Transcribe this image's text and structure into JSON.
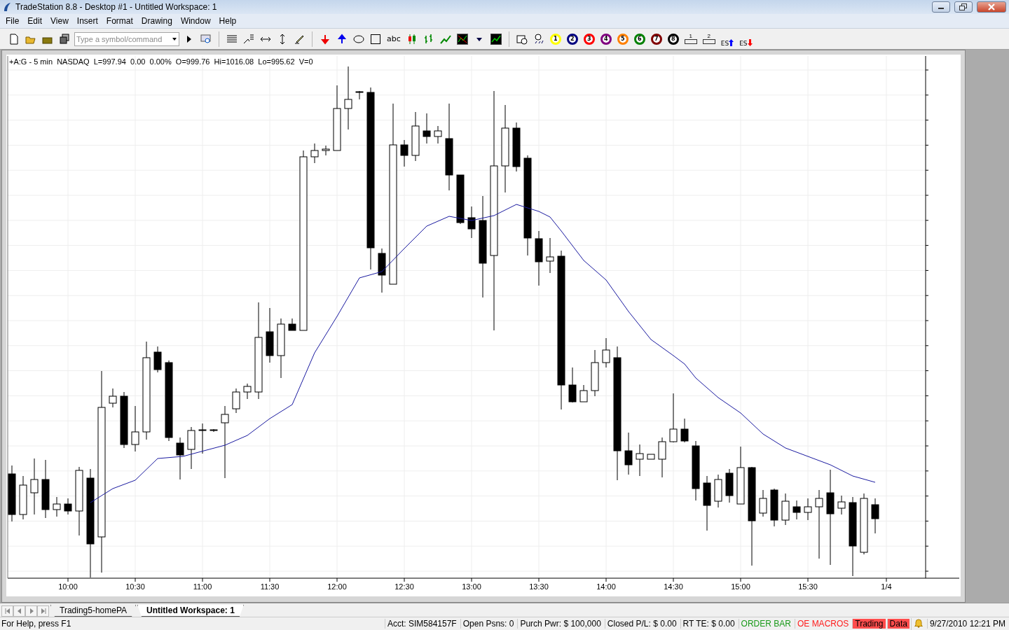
{
  "window": {
    "title": "TradeStation 8.8 - Desktop #1 - Untitled Workspace:  1"
  },
  "menu": [
    "File",
    "Edit",
    "View",
    "Insert",
    "Format",
    "Drawing",
    "Window",
    "Help"
  ],
  "toolbar": {
    "symbol_field": {
      "placeholder": "Type a symbol/command"
    },
    "text_tool": "abc",
    "balls": [
      {
        "label": "1",
        "color": "#ffff00"
      },
      {
        "label": "2",
        "color": "#000080"
      },
      {
        "label": "3",
        "color": "#ff0000"
      },
      {
        "label": "4",
        "color": "#800080"
      },
      {
        "label": "5",
        "color": "#ff8000"
      },
      {
        "label": "6",
        "color": "#008000"
      },
      {
        "label": "7",
        "color": "#800000"
      },
      {
        "label": "8",
        "color": "#000000"
      }
    ],
    "position_buttons": [
      "1",
      "2"
    ],
    "es_buttons": [
      {
        "label": "ES",
        "kind": "up"
      },
      {
        "label": "ES",
        "kind": "down"
      }
    ]
  },
  "chart": {
    "header": "+A:G - 5 min  NASDAQ  L=997.94  0.00  0.00%  O=999.76  Hi=1016.08  Lo=995.62  V=0",
    "time_labels": [
      "10:00",
      "10:30",
      "11:00",
      "11:30",
      "12:00",
      "12:30",
      "13:00",
      "13:30",
      "14:00",
      "14:30",
      "15:00",
      "15:30",
      "1/4"
    ]
  },
  "workspace_tabs": [
    {
      "label": "Trading5-homePA",
      "selected": false
    },
    {
      "label": "Untitled Workspace:  1",
      "selected": true
    }
  ],
  "status_bar": [
    {
      "text": "For Help, press F1",
      "kind": "help"
    },
    {
      "text": "Acct: SIM584157F",
      "kind": "plain"
    },
    {
      "text": "Open Psns: 0",
      "kind": "plain"
    },
    {
      "text": "Purch Pwr: $ 100,000",
      "kind": "plain"
    },
    {
      "text": "Closed P/L: $ 0.00",
      "kind": "plain"
    },
    {
      "text": "RT TE: $ 0.00",
      "kind": "plain"
    },
    {
      "text": "ORDER BAR",
      "kind": "green"
    },
    {
      "text": "OE MACROS",
      "kind": "red"
    },
    {
      "text": "Trading",
      "kind": "alert"
    },
    {
      "text": "Data",
      "kind": "alert"
    },
    {
      "kind": "bell"
    },
    {
      "text": "9/27/2010 12:21 PM",
      "kind": "plain"
    }
  ]
}
